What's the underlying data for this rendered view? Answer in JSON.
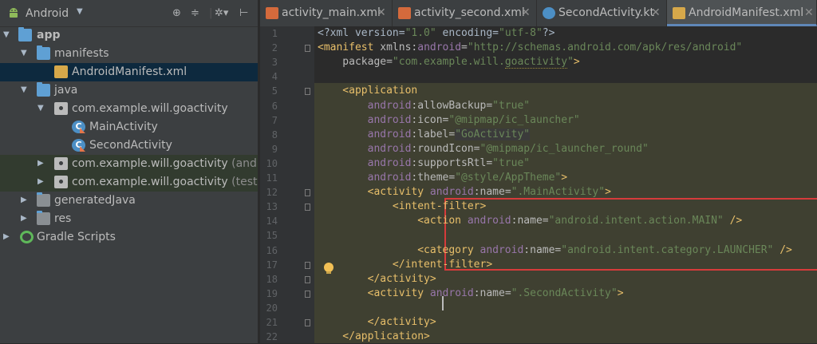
{
  "project_panel": {
    "title": "Android",
    "tree": [
      {
        "label": "app",
        "suffix": "",
        "icon": "app-module-icon",
        "state": "expanded"
      },
      {
        "label": "manifests",
        "suffix": "",
        "icon": "folder-icon",
        "state": "expanded"
      },
      {
        "label": "AndroidManifest.xml",
        "suffix": "",
        "icon": "xml-file-icon",
        "state": "selected"
      },
      {
        "label": "java",
        "suffix": "",
        "icon": "folder-icon",
        "state": "expanded"
      },
      {
        "label": "com.example.will.goactivity",
        "suffix": "",
        "icon": "package-icon",
        "state": "expanded"
      },
      {
        "label": "MainActivity",
        "suffix": "",
        "icon": "kotlin-class-icon",
        "state": "leaf"
      },
      {
        "label": "SecondActivity",
        "suffix": "",
        "icon": "kotlin-class-icon",
        "state": "leaf"
      },
      {
        "label": "com.example.will.goactivity",
        "suffix": " (androic",
        "icon": "package-icon",
        "state": "collapsed"
      },
      {
        "label": "com.example.will.goactivity",
        "suffix": " (test)",
        "icon": "package-icon",
        "state": "collapsed"
      },
      {
        "label": "generatedJava",
        "suffix": "",
        "icon": "generated-folder-icon",
        "state": "collapsed"
      },
      {
        "label": "res",
        "suffix": "",
        "icon": "res-folder-icon",
        "state": "collapsed"
      },
      {
        "label": "Gradle Scripts",
        "suffix": "",
        "icon": "gradle-icon",
        "state": "collapsed"
      }
    ]
  },
  "editor": {
    "tabs": [
      {
        "label": "activity_main.xml",
        "icon": "xml-file-icon",
        "active": false
      },
      {
        "label": "activity_second.xml",
        "icon": "xml-file-icon",
        "active": false
      },
      {
        "label": "SecondActivity.kt",
        "icon": "kotlin-file-icon",
        "active": false
      },
      {
        "label": "AndroidManifest.xml",
        "icon": "manifest-file-icon",
        "active": true
      }
    ],
    "line_numbers": [
      "1",
      "2",
      "3",
      "4",
      "5",
      "6",
      "7",
      "8",
      "9",
      "10",
      "11",
      "12",
      "13",
      "14",
      "15",
      "16",
      "17",
      "18",
      "19",
      "20",
      "21",
      "22"
    ],
    "lines": [
      [
        [
          "plain",
          "<?xml version="
        ],
        [
          "val",
          "\"1.0\""
        ],
        [
          "plain",
          " encoding="
        ],
        [
          "val",
          "\"utf-8\""
        ],
        [
          "plain",
          "?>"
        ]
      ],
      [
        [
          "tag",
          "<manifest "
        ],
        [
          "attr",
          "xmlns:"
        ],
        [
          "pfx",
          "android"
        ],
        [
          "attr",
          "="
        ],
        [
          "val",
          "\"http://schemas.android.com/apk/res/android\""
        ]
      ],
      [
        [
          "attr",
          "    package="
        ],
        [
          "val",
          "\"com.example.will."
        ],
        [
          "val",
          "goactivity"
        ],
        [
          "val",
          "\""
        ],
        [
          "tag",
          ">"
        ]
      ],
      [],
      [
        [
          "tag",
          "    <application"
        ]
      ],
      [
        [
          "pfx",
          "        android"
        ],
        [
          "attr",
          ":allowBackup="
        ],
        [
          "val",
          "\"true\""
        ]
      ],
      [
        [
          "pfx",
          "        android"
        ],
        [
          "attr",
          ":icon="
        ],
        [
          "val",
          "\"@mipmap/ic_launcher\""
        ]
      ],
      [
        [
          "pfx",
          "        android"
        ],
        [
          "attr",
          ":label="
        ],
        [
          "val",
          "\"GoActivity\""
        ]
      ],
      [
        [
          "pfx",
          "        android"
        ],
        [
          "attr",
          ":roundIcon="
        ],
        [
          "val",
          "\"@mipmap/ic_launcher_round\""
        ]
      ],
      [
        [
          "pfx",
          "        android"
        ],
        [
          "attr",
          ":supportsRtl="
        ],
        [
          "val",
          "\"true\""
        ]
      ],
      [
        [
          "pfx",
          "        android"
        ],
        [
          "attr",
          ":theme="
        ],
        [
          "val",
          "\"@style/AppTheme\""
        ],
        [
          "tag",
          ">"
        ]
      ],
      [
        [
          "tag",
          "        <activity "
        ],
        [
          "pfx",
          "android"
        ],
        [
          "attr",
          ":name="
        ],
        [
          "val",
          "\".MainActivity\""
        ],
        [
          "tag",
          ">"
        ]
      ],
      [
        [
          "tag",
          "            <intent-filter>"
        ]
      ],
      [
        [
          "tag",
          "                <action "
        ],
        [
          "pfx",
          "android"
        ],
        [
          "attr",
          ":name="
        ],
        [
          "val",
          "\"android.intent.action.MAIN\""
        ],
        [
          "tag",
          " />"
        ]
      ],
      [],
      [
        [
          "tag",
          "                <category "
        ],
        [
          "pfx",
          "android"
        ],
        [
          "attr",
          ":name="
        ],
        [
          "val",
          "\"android.intent.category.LAUNCHER\""
        ],
        [
          "tag",
          " />"
        ]
      ],
      [
        [
          "tag",
          "            </intent-filter>"
        ]
      ],
      [
        [
          "tag",
          "        </activity>"
        ]
      ],
      [
        [
          "tag",
          "        <activity "
        ],
        [
          "pfx",
          "android"
        ],
        [
          "attr",
          ":name="
        ],
        [
          "val",
          "\".SecondActivity\""
        ],
        [
          "tag",
          ">"
        ]
      ],
      [],
      [
        [
          "tag",
          "        </activity>"
        ]
      ],
      [
        [
          "tag",
          "    </application>"
        ]
      ]
    ]
  }
}
